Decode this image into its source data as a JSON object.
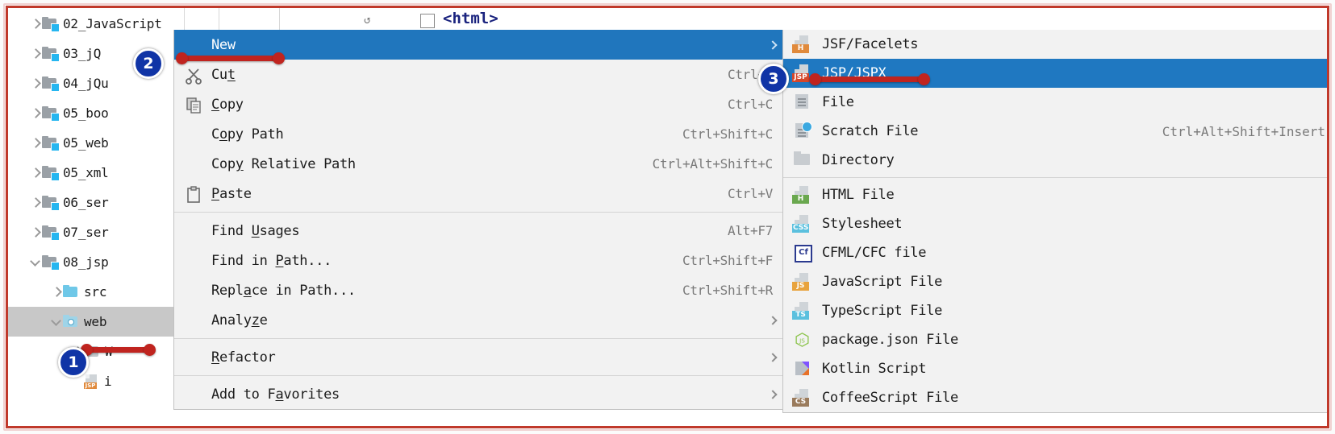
{
  "window": {
    "app": "IntelliJ IDEA Project Tool Window with context menu",
    "editor_tab_label": "<html>"
  },
  "tree": {
    "items": [
      {
        "label": "02_JavaScript",
        "expander": "right",
        "icon": "module-folder-icon",
        "indent": 1,
        "selected": false
      },
      {
        "label": "03_jQ",
        "expander": "right",
        "icon": "module-folder-icon",
        "indent": 1,
        "selected": false
      },
      {
        "label": "04_jQu",
        "expander": "right",
        "icon": "module-folder-icon",
        "indent": 1,
        "selected": false
      },
      {
        "label": "05_boo",
        "expander": "right",
        "icon": "module-folder-icon",
        "indent": 1,
        "selected": false
      },
      {
        "label": "05_web",
        "expander": "right",
        "icon": "module-folder-icon",
        "indent": 1,
        "selected": false
      },
      {
        "label": "05_xml",
        "expander": "right",
        "icon": "module-folder-icon",
        "indent": 1,
        "selected": false
      },
      {
        "label": "06_ser",
        "expander": "right",
        "icon": "module-folder-icon",
        "indent": 1,
        "selected": false
      },
      {
        "label": "07_ser",
        "expander": "right",
        "icon": "module-folder-icon",
        "indent": 1,
        "selected": false
      },
      {
        "label": "08_jsp",
        "expander": "down",
        "icon": "module-folder-icon",
        "indent": 1,
        "selected": false
      },
      {
        "label": "src",
        "expander": "right",
        "icon": "source-folder-icon",
        "indent": 2,
        "selected": false
      },
      {
        "label": "web",
        "expander": "down",
        "icon": "web-folder-icon",
        "indent": 2,
        "selected": true
      },
      {
        "label": "W",
        "expander": "right",
        "icon": "folder-icon",
        "indent": 3,
        "selected": false
      },
      {
        "label": "i",
        "expander": "none",
        "icon": "jsp-file-icon",
        "indent": 3,
        "selected": false
      }
    ]
  },
  "context_menu": {
    "items": [
      {
        "label": "New",
        "shortcut": "",
        "icon": "",
        "submenu": true,
        "highlighted": true
      },
      {
        "label": "Cut",
        "shortcut": "Ctrl+X",
        "icon": "cut-icon",
        "submenu": false,
        "highlighted": false,
        "mnemonic": "t"
      },
      {
        "label": "Copy",
        "shortcut": "Ctrl+C",
        "icon": "copy-icon",
        "submenu": false,
        "highlighted": false,
        "mnemonic": "C"
      },
      {
        "label": "Copy Path",
        "shortcut": "Ctrl+Shift+C",
        "icon": "",
        "submenu": false,
        "highlighted": false,
        "mnemonic": "o"
      },
      {
        "label": "Copy Relative Path",
        "shortcut": "Ctrl+Alt+Shift+C",
        "icon": "",
        "submenu": false,
        "highlighted": false,
        "mnemonic": "y"
      },
      {
        "label": "Paste",
        "shortcut": "Ctrl+V",
        "icon": "paste-icon",
        "submenu": false,
        "highlighted": false,
        "mnemonic": "P"
      },
      {
        "separator": true
      },
      {
        "label": "Find Usages",
        "shortcut": "Alt+F7",
        "icon": "",
        "submenu": false,
        "highlighted": false,
        "mnemonic": "U"
      },
      {
        "label": "Find in Path...",
        "shortcut": "Ctrl+Shift+F",
        "icon": "",
        "submenu": false,
        "highlighted": false,
        "mnemonic": "P"
      },
      {
        "label": "Replace in Path...",
        "shortcut": "Ctrl+Shift+R",
        "icon": "",
        "submenu": false,
        "highlighted": false,
        "mnemonic": "a"
      },
      {
        "label": "Analyze",
        "shortcut": "",
        "icon": "",
        "submenu": true,
        "highlighted": false,
        "mnemonic": "z"
      },
      {
        "separator": true
      },
      {
        "label": "Refactor",
        "shortcut": "",
        "icon": "",
        "submenu": true,
        "highlighted": false,
        "mnemonic": "R"
      },
      {
        "separator": true
      },
      {
        "label": "Add to Favorites",
        "shortcut": "",
        "icon": "",
        "submenu": true,
        "highlighted": false,
        "mnemonic": "a"
      }
    ]
  },
  "submenu": {
    "items": [
      {
        "label": "JSF/Facelets",
        "shortcut": "",
        "icon": "jsf-file-icon",
        "tag": "H",
        "tag_color": "#e08a3c",
        "highlighted": false
      },
      {
        "label": "JSP/JSPX",
        "shortcut": "",
        "icon": "jsp-file-icon",
        "tag": "JSP",
        "tag_color": "#d4462a",
        "highlighted": true
      },
      {
        "label": "File",
        "shortcut": "",
        "icon": "file-icon",
        "tag": "",
        "tag_color": "",
        "highlighted": false
      },
      {
        "label": "Scratch File",
        "shortcut": "Ctrl+Alt+Shift+Insert",
        "icon": "scratch-file-icon",
        "tag": "",
        "tag_color": "",
        "highlighted": false
      },
      {
        "label": "Directory",
        "shortcut": "",
        "icon": "directory-icon",
        "tag": "",
        "tag_color": "",
        "highlighted": false
      },
      {
        "separator": true
      },
      {
        "label": "HTML File",
        "shortcut": "",
        "icon": "html-file-icon",
        "tag": "H",
        "tag_color": "#6aa84f",
        "highlighted": false
      },
      {
        "label": "Stylesheet",
        "shortcut": "",
        "icon": "css-file-icon",
        "tag": "CSS",
        "tag_color": "#5bc0de",
        "highlighted": false
      },
      {
        "label": "CFML/CFC file",
        "shortcut": "",
        "icon": "cfml-file-icon",
        "tag": "Cf",
        "tag_color": "#2b3a8f",
        "highlighted": false
      },
      {
        "label": "JavaScript File",
        "shortcut": "",
        "icon": "javascript-file-icon",
        "tag": "JS",
        "tag_color": "#e8a33d",
        "highlighted": false
      },
      {
        "label": "TypeScript File",
        "shortcut": "",
        "icon": "typescript-file-icon",
        "tag": "TS",
        "tag_color": "#5bc0de",
        "highlighted": false
      },
      {
        "label": "package.json File",
        "shortcut": "",
        "icon": "nodejs-icon",
        "tag": "",
        "tag_color": "#8bc34a",
        "highlighted": false
      },
      {
        "label": "Kotlin Script",
        "shortcut": "",
        "icon": "kotlin-script-icon",
        "tag": "",
        "tag_color": "",
        "highlighted": false
      },
      {
        "label": "CoffeeScript File",
        "shortcut": "",
        "icon": "coffeescript-file-icon",
        "tag": "",
        "tag_color": "",
        "highlighted": false
      }
    ]
  },
  "callouts": [
    {
      "number": "1",
      "target": "web-tree-node"
    },
    {
      "number": "2",
      "target": "new-menu-item"
    },
    {
      "number": "3",
      "target": "jsp-jspx-submenu-item"
    }
  ],
  "colors": {
    "menu_highlight": "#2076bd",
    "submenu_highlight": "#1f78c1",
    "annotation_red": "#c0241f",
    "badge_blue": "#1034a6",
    "frame_red": "#c0392b",
    "tree_selection": "#c8c8c8"
  }
}
